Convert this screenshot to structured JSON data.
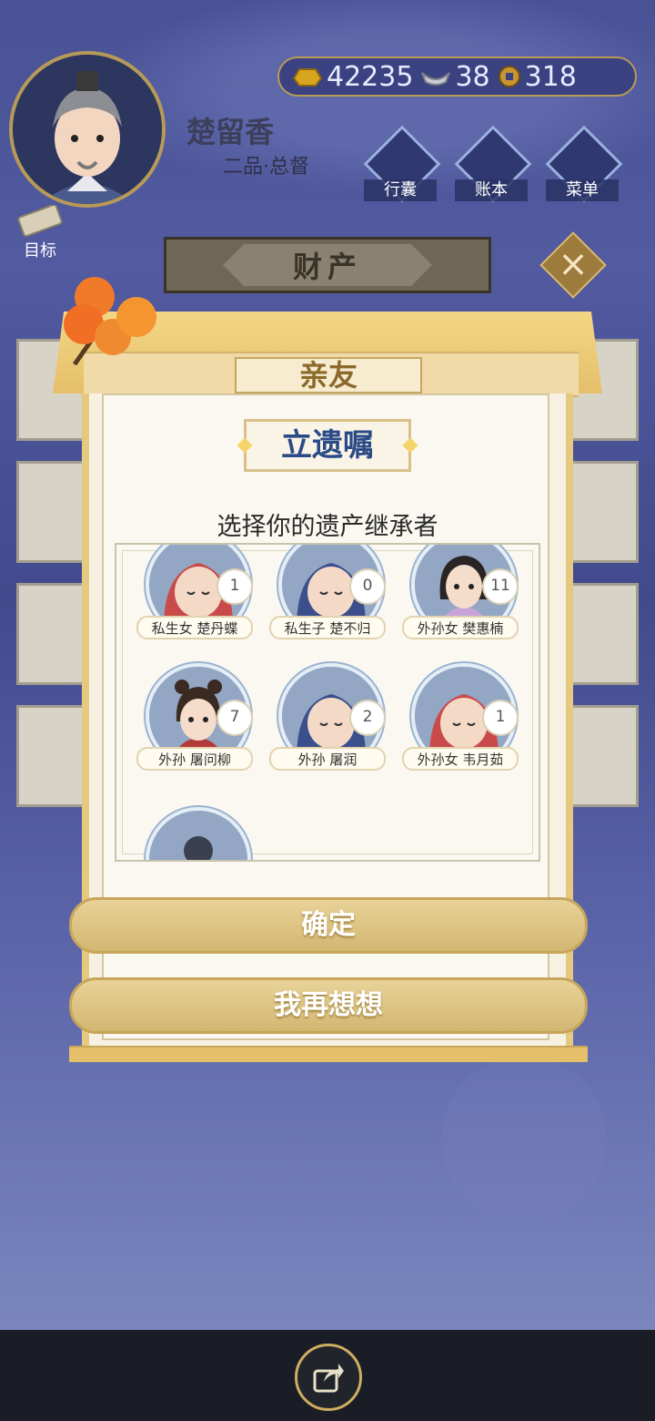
{
  "player": {
    "name": "楚留香",
    "rank": "二品·总督"
  },
  "currency": {
    "gold": "42235",
    "silver": "38",
    "coins": "318"
  },
  "menu": [
    {
      "label": "行囊"
    },
    {
      "label": "账本"
    },
    {
      "label": "菜单"
    }
  ],
  "goal_label": "目标",
  "property_title": "财产",
  "modal": {
    "tab_title": "亲友",
    "heading": "立遗嘱",
    "subtitle": "选择你的遗产继承者",
    "heirs": [
      {
        "name": "私生女 楚丹蝶",
        "count": "1",
        "hood": "#c94a4a"
      },
      {
        "name": "私生子 楚不归",
        "count": "0",
        "hood": "#3b4f8c"
      },
      {
        "name": "外孙女 樊惠楠",
        "count": "11",
        "hood": "#c6a3d8"
      },
      {
        "name": "外孙 屠问柳",
        "count": "7",
        "hood": "#b33a3a"
      },
      {
        "name": "外孙 屠润",
        "count": "2",
        "hood": "#3b4f8c"
      },
      {
        "name": "外孙女 韦月茹",
        "count": "1",
        "hood": "#c94a4a"
      }
    ],
    "confirm_label": "确定",
    "reconsider_label": "我再想想"
  }
}
